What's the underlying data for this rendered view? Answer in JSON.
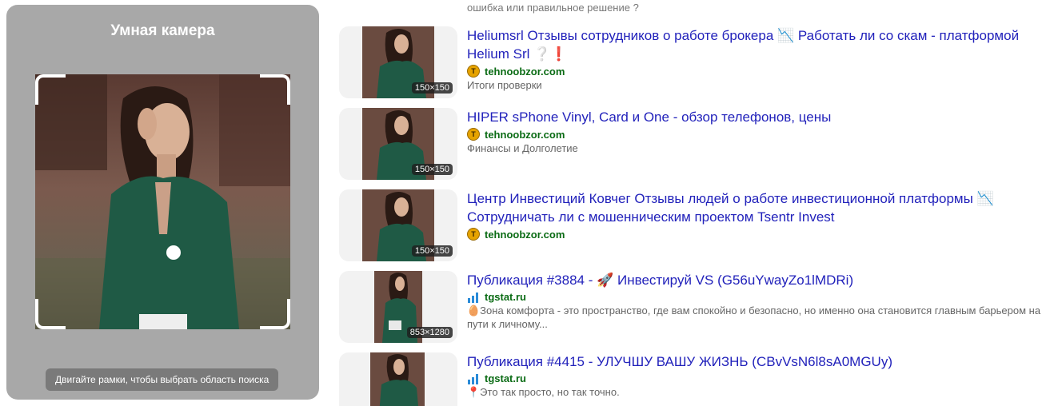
{
  "camera": {
    "title": "Умная камера",
    "hint": "Двигайте рамки, чтобы выбрать область поиска"
  },
  "top_snippet": "ошибка или правильное решение ?",
  "results": [
    {
      "title": "Heliumsrl Отзывы сотрудников о работе брокера 📉 Работать ли со скам - платформой Helium Srl ❔❗",
      "source": "tehnoobzor.com",
      "source_icon": "tehnoobzor-icon",
      "description": "Итоги проверки",
      "size": "150×150"
    },
    {
      "title": "HIPER sPhone Vinyl, Card и One - обзор телефонов, цены",
      "source": "tehnoobzor.com",
      "source_icon": "tehnoobzor-icon",
      "description": "Финансы и Долголетие",
      "size": "150×150"
    },
    {
      "title": "Центр Инвестиций Ковчег Отзывы людей о работе инвестиционной платформы 📉 Сотрудничать ли с мошенническим проектом Tsentr Invest",
      "source": "tehnoobzor.com",
      "source_icon": "tehnoobzor-icon",
      "description": "",
      "size": "150×150"
    },
    {
      "title": "Публикация #3884 - 🚀 Инвестируй VS (G56uYwayZo1lMDRi)",
      "source": "tgstat.ru",
      "source_icon": "tgstat-icon",
      "description": "🥚Зона комфорта - это пространство, где вам спокойно и безопасно, но именно она становится главным барьером на пути к личному...",
      "size": "853×1280"
    },
    {
      "title": "Публикация #4415 - УЛУЧШУ ВАШУ ЖИЗНЬ (CBvVsN6l8sA0MGUy)",
      "source": "tgstat.ru",
      "source_icon": "tgstat-icon",
      "description": "📍Это так просто, но так точно.",
      "size": ""
    }
  ]
}
